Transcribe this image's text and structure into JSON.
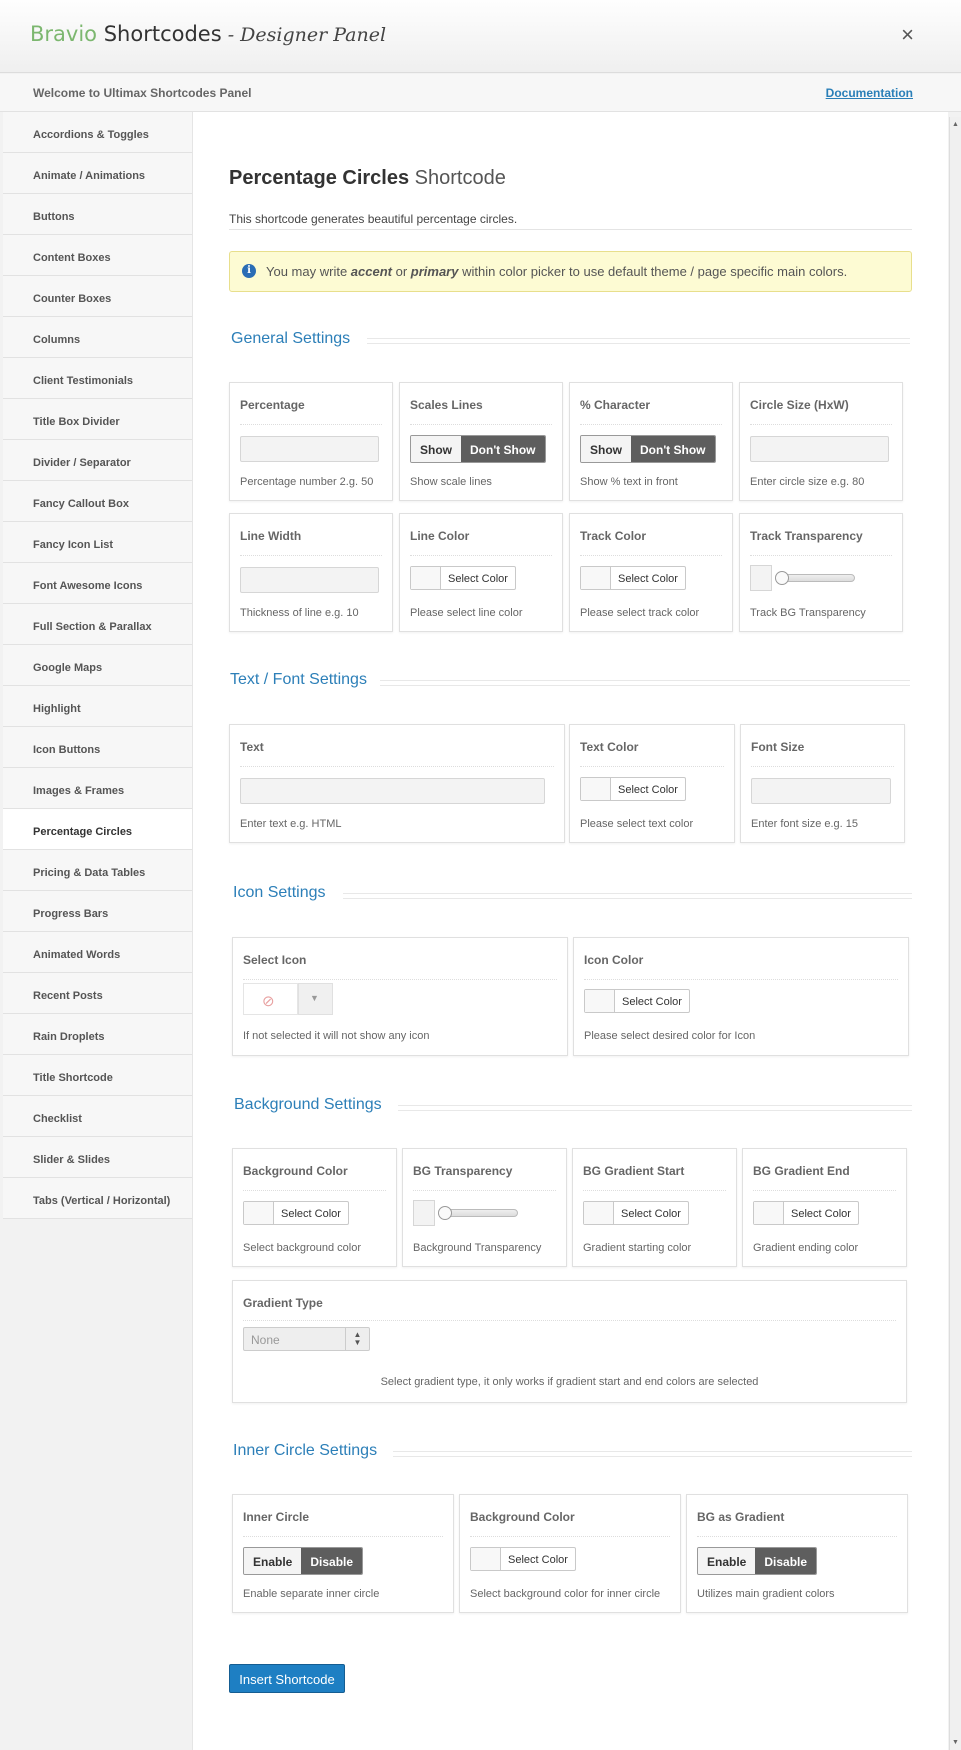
{
  "header": {
    "brand_a": "Bravio",
    "brand_b": "Shortcodes",
    "brand_sep": " - ",
    "brand_c": "Designer Panel",
    "close": "×"
  },
  "subheader": {
    "welcome": "Welcome to Ultimax Shortcodes Panel",
    "doc": "Documentation"
  },
  "sidebar": {
    "items": [
      "Accordions & Toggles",
      "Animate / Animations",
      "Buttons",
      "Content Boxes",
      "Counter Boxes",
      "Columns",
      "Client Testimonials",
      "Title Box Divider",
      "Divider / Separator",
      "Fancy Callout Box",
      "Fancy Icon List",
      "Font Awesome Icons",
      "Full Section & Parallax",
      "Google Maps",
      "Highlight",
      "Icon Buttons",
      "Images & Frames",
      "Percentage Circles",
      "Pricing & Data Tables",
      "Progress Bars",
      "Animated Words",
      "Recent Posts",
      "Rain Droplets",
      "Title Shortcode",
      "Checklist",
      "Slider & Slides",
      "Tabs (Vertical / Horizontal)"
    ],
    "active": "Percentage Circles"
  },
  "main": {
    "title_bold": "Percentage Circles",
    "title_light": "Shortcode",
    "description": "This shortcode generates beautiful percentage circles.",
    "notice": {
      "icon": "i",
      "a": "You may write ",
      "b": "accent",
      "c": " or ",
      "d": "primary",
      "e": " within color picker to use default theme / page specific main colors."
    },
    "general": {
      "title": "General Settings",
      "percentage": {
        "label": "Percentage",
        "help": "Percentage number 2.g. 50"
      },
      "scales": {
        "label": "Scales Lines",
        "on": "Show",
        "off": "Don't Show",
        "help": "Show scale lines"
      },
      "character": {
        "label": "% Character",
        "on": "Show",
        "off": "Don't Show",
        "help": "Show % text in front"
      },
      "circle_size": {
        "label": "Circle Size (HxW)",
        "help": "Enter circle size e.g. 80"
      },
      "line_width": {
        "label": "Line Width",
        "help": "Thickness of line e.g. 10"
      },
      "line_color": {
        "label": "Line Color",
        "btn": "Select Color",
        "help": "Please select line color"
      },
      "track_color": {
        "label": "Track Color",
        "btn": "Select Color",
        "help": "Please select track color"
      },
      "track_transparency": {
        "label": "Track Transparency",
        "help": "Track BG Transparency",
        "value": 0
      }
    },
    "text": {
      "title": "Text / Font Settings",
      "text": {
        "label": "Text",
        "help": "Enter text e.g. HTML"
      },
      "text_color": {
        "label": "Text Color",
        "btn": "Select Color",
        "help": "Please select text color"
      },
      "font_size": {
        "label": "Font Size",
        "help": "Enter font size e.g. 15"
      }
    },
    "icon": {
      "title": "Icon Settings",
      "select_icon": {
        "label": "Select Icon",
        "help": "If not selected it will not show any icon"
      },
      "icon_color": {
        "label": "Icon Color",
        "btn": "Select Color",
        "help": "Please select desired color for Icon"
      }
    },
    "background": {
      "title": "Background Settings",
      "bg_color": {
        "label": "Background Color",
        "btn": "Select Color",
        "help": "Select background color"
      },
      "bg_transparency": {
        "label": "BG Transparency",
        "help": "Background Transparency",
        "value": 0
      },
      "grad_start": {
        "label": "BG Gradient Start",
        "btn": "Select Color",
        "help": "Gradient starting color"
      },
      "grad_end": {
        "label": "BG Gradient End",
        "btn": "Select Color",
        "help": "Gradient ending color"
      },
      "grad_type": {
        "label": "Gradient Type",
        "value": "None",
        "help": "Select gradient type, it only works if gradient start and end colors are selected"
      }
    },
    "inner": {
      "title": "Inner Circle Settings",
      "inner_circle": {
        "label": "Inner Circle",
        "on": "Enable",
        "off": "Disable",
        "help": "Enable separate inner circle"
      },
      "bg_color": {
        "label": "Background Color",
        "btn": "Select Color",
        "help": "Select background color for inner circle"
      },
      "bg_gradient": {
        "label": "BG as Gradient",
        "on": "Enable",
        "off": "Disable",
        "help": "Utilizes main gradient colors"
      }
    },
    "insert": "Insert Shortcode"
  },
  "colors": {
    "accent": "#2c7fb8",
    "brand_green": "#7cb76f",
    "button": "#1e7fc3"
  }
}
